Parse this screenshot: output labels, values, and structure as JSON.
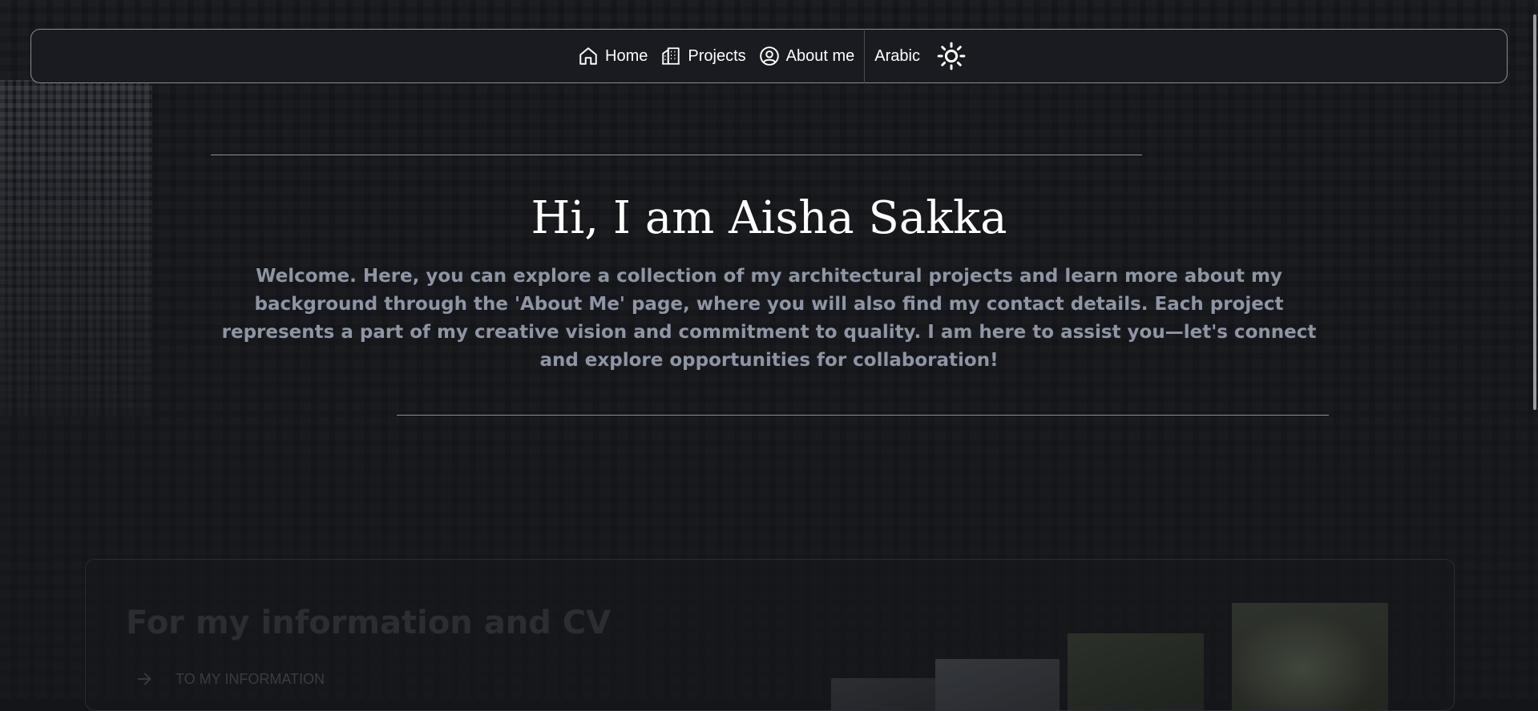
{
  "nav": {
    "home_label": "Home",
    "projects_label": "Projects",
    "about_label": "About me",
    "language_label": "Arabic"
  },
  "hero": {
    "title": "Hi, I am Aisha Sakka",
    "text": "Welcome. Here, you can explore a collection of my architectural projects and learn more about my background through the 'About Me' page, where you will also find my contact details. Each project represents a part of my creative vision and commitment to quality. I am here to assist you—let's connect and explore opportunities for collaboration!"
  },
  "card": {
    "title": "For my information and CV",
    "link_label": "TO MY INFORMATION"
  },
  "colors": {
    "background": "#141519",
    "text_muted": "#8e95a3",
    "border": "#8a8c92"
  },
  "icons": {
    "home": "home-icon",
    "projects": "buildings-icon",
    "about": "user-circle-icon",
    "theme": "sun-icon",
    "link": "arrow-right-icon"
  }
}
